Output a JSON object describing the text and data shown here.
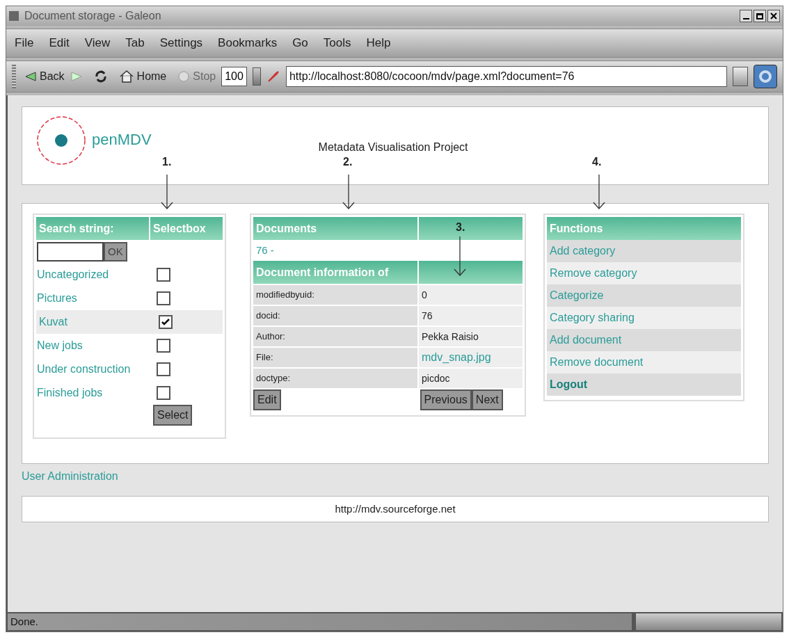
{
  "window": {
    "title": "Document storage - Galeon"
  },
  "menu": [
    "File",
    "Edit",
    "View",
    "Tab",
    "Settings",
    "Bookmarks",
    "Go",
    "Tools",
    "Help"
  ],
  "toolbar": {
    "back": "Back",
    "home": "Home",
    "stop": "Stop",
    "stop_disabled": true,
    "zoom": "100",
    "url": "http://localhost:8080/cocoon/mdv/page.xml?document=76"
  },
  "header": {
    "logo_text": "penMDV",
    "subtitle": "Metadata Visualisation Project"
  },
  "annotations": [
    "1.",
    "2.",
    "3.",
    "4."
  ],
  "search_panel": {
    "headers": [
      "Search string:",
      "Selectbox"
    ],
    "ok": "OK",
    "categories": [
      {
        "label": "Uncategorized",
        "checked": false,
        "selected": false
      },
      {
        "label": "Pictures",
        "checked": false,
        "selected": false
      },
      {
        "label": "Kuvat",
        "checked": true,
        "selected": true
      },
      {
        "label": "New jobs",
        "checked": false,
        "selected": false
      },
      {
        "label": "Under construction",
        "checked": false,
        "selected": false
      },
      {
        "label": "Finished jobs",
        "checked": false,
        "selected": false
      }
    ],
    "select": "Select"
  },
  "documents_panel": {
    "header": "Documents",
    "document_link": "76 -",
    "info_header": "Document information of",
    "rows": [
      {
        "label": "modifiedbyuid:",
        "value": "0",
        "kind": "text"
      },
      {
        "label": "docid:",
        "value": "76",
        "kind": "text"
      },
      {
        "label": "Author:",
        "value": "Pekka Raisio",
        "kind": "text"
      },
      {
        "label": "File:",
        "value": "mdv_snap.jpg",
        "kind": "link"
      },
      {
        "label": "doctype:",
        "value": "picdoc",
        "kind": "text"
      }
    ],
    "edit": "Edit",
    "previous": "Previous",
    "next": "Next"
  },
  "functions_panel": {
    "header": "Functions",
    "items": [
      {
        "label": "Add category",
        "kind": "link"
      },
      {
        "label": "Remove category",
        "kind": "link"
      },
      {
        "label": "Categorize",
        "kind": "link"
      },
      {
        "label": "Category sharing",
        "kind": "link"
      },
      {
        "label": "Add document",
        "kind": "link"
      },
      {
        "label": "Remove document",
        "kind": "link"
      },
      {
        "label": "Logout",
        "kind": "strong"
      }
    ]
  },
  "user_admin": "User Administration",
  "footer_url": "http://mdv.sourceforge.net",
  "status": "Done."
}
